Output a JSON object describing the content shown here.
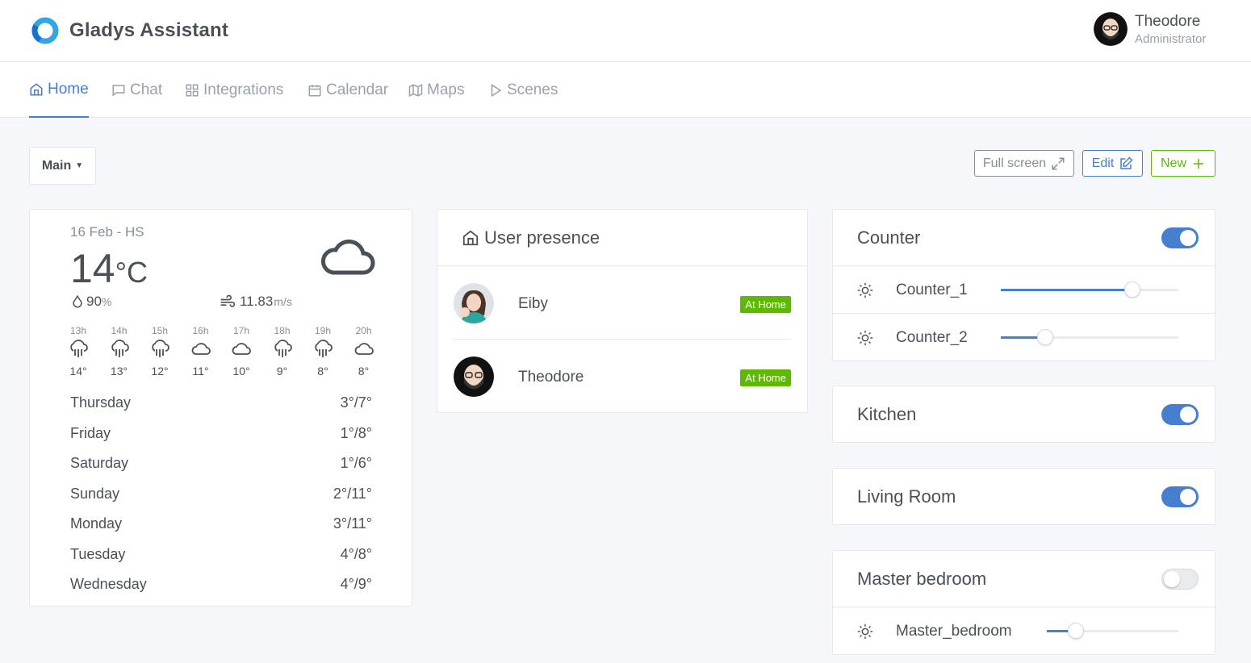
{
  "app": {
    "title": "Gladys Assistant"
  },
  "user": {
    "name": "Theodore",
    "role": "Administrator"
  },
  "nav": {
    "tabs": [
      {
        "label": "Home",
        "icon": "home-icon",
        "active": true
      },
      {
        "label": "Chat",
        "icon": "chat-icon"
      },
      {
        "label": "Integrations",
        "icon": "grid-icon"
      },
      {
        "label": "Calendar",
        "icon": "calendar-icon"
      },
      {
        "label": "Maps",
        "icon": "map-icon"
      },
      {
        "label": "Scenes",
        "icon": "play-icon"
      }
    ]
  },
  "toolbar": {
    "dashboard_select": "Main",
    "fullscreen_label": "Full screen",
    "edit_label": "Edit",
    "new_label": "New"
  },
  "weather": {
    "date": "16 Feb - HS",
    "temperature": "14",
    "unit": "°C",
    "humidity": "90",
    "humidity_unit": "%",
    "wind": "11.83",
    "wind_unit": "m/s",
    "icon": "cloud-icon",
    "hours": [
      {
        "hour": "13h",
        "temp": "14°",
        "icon": "rain-icon"
      },
      {
        "hour": "14h",
        "temp": "13°",
        "icon": "rain-icon"
      },
      {
        "hour": "15h",
        "temp": "12°",
        "icon": "rain-icon"
      },
      {
        "hour": "16h",
        "temp": "11°",
        "icon": "cloud-icon"
      },
      {
        "hour": "17h",
        "temp": "10°",
        "icon": "cloud-icon"
      },
      {
        "hour": "18h",
        "temp": "9°",
        "icon": "rain-icon"
      },
      {
        "hour": "19h",
        "temp": "8°",
        "icon": "rain-icon"
      },
      {
        "hour": "20h",
        "temp": "8°",
        "icon": "cloud-icon"
      }
    ],
    "days": [
      {
        "day": "Thursday",
        "range": "3°/7°"
      },
      {
        "day": "Friday",
        "range": "1°/8°"
      },
      {
        "day": "Saturday",
        "range": "1°/6°"
      },
      {
        "day": "Sunday",
        "range": "2°/11°"
      },
      {
        "day": "Monday",
        "range": "3°/11°"
      },
      {
        "day": "Tuesday",
        "range": "4°/8°"
      },
      {
        "day": "Wednesday",
        "range": "4°/9°"
      }
    ]
  },
  "presence": {
    "title": "User presence",
    "users": [
      {
        "name": "Eiby",
        "status": "At Home"
      },
      {
        "name": "Theodore",
        "status": "At Home"
      }
    ]
  },
  "rooms": [
    {
      "name": "Counter",
      "on": true,
      "devices": [
        {
          "label": "Counter_1",
          "level": 0.74
        },
        {
          "label": "Counter_2",
          "level": 0.25
        }
      ]
    },
    {
      "name": "Kitchen",
      "on": true,
      "devices": []
    },
    {
      "name": "Living Room",
      "on": true,
      "devices": []
    },
    {
      "name": "Master bedroom",
      "on": false,
      "devices": [
        {
          "label": "Master_bedroom",
          "level": 0.22
        }
      ]
    }
  ],
  "colors": {
    "accent": "#467fcf",
    "success": "#5eba00",
    "muted": "#9aa0ac"
  }
}
